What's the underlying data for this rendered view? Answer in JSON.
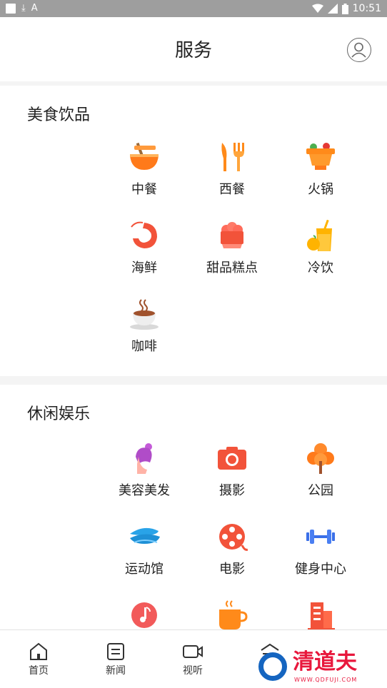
{
  "status_bar": {
    "time": "10:51",
    "download_glyph": "⤓",
    "a_glyph": "A"
  },
  "header": {
    "title": "服务"
  },
  "sections": [
    {
      "title": "美食饮品",
      "items": [
        {
          "label": "中餐",
          "icon": "noodle-bowl-icon"
        },
        {
          "label": "西餐",
          "icon": "fork-knife-icon"
        },
        {
          "label": "火锅",
          "icon": "hotpot-icon"
        },
        {
          "label": "海鲜",
          "icon": "shrimp-icon"
        },
        {
          "label": "甜品糕点",
          "icon": "cake-icon"
        },
        {
          "label": "冷饮",
          "icon": "cold-drink-icon"
        },
        {
          "label": "咖啡",
          "icon": "coffee-cup-icon"
        }
      ]
    },
    {
      "title": "休闲娱乐",
      "items": [
        {
          "label": "美容美发",
          "icon": "beauty-hair-icon"
        },
        {
          "label": "摄影",
          "icon": "camera-icon"
        },
        {
          "label": "公园",
          "icon": "tree-icon"
        },
        {
          "label": "运动馆",
          "icon": "stadium-icon"
        },
        {
          "label": "电影",
          "icon": "film-reel-icon"
        },
        {
          "label": "健身中心",
          "icon": "dumbbell-icon"
        },
        {
          "label": "",
          "icon": "music-icon"
        },
        {
          "label": "",
          "icon": "tea-cup-icon"
        },
        {
          "label": "",
          "icon": "building-icon"
        }
      ]
    }
  ],
  "tabbar": {
    "tabs": [
      {
        "label": "首页",
        "icon": "home-icon"
      },
      {
        "label": "新闻",
        "icon": "news-icon"
      },
      {
        "label": "视听",
        "icon": "video-icon"
      },
      {
        "label": "",
        "icon": "service-icon"
      }
    ]
  },
  "watermark": {
    "text": "清道夫",
    "url": "WWW.QDFUJI.COM"
  },
  "colors": {
    "accent_orange": "#ff7a1a",
    "accent_red": "#f2533a",
    "watermark_red": "#e8173c"
  }
}
